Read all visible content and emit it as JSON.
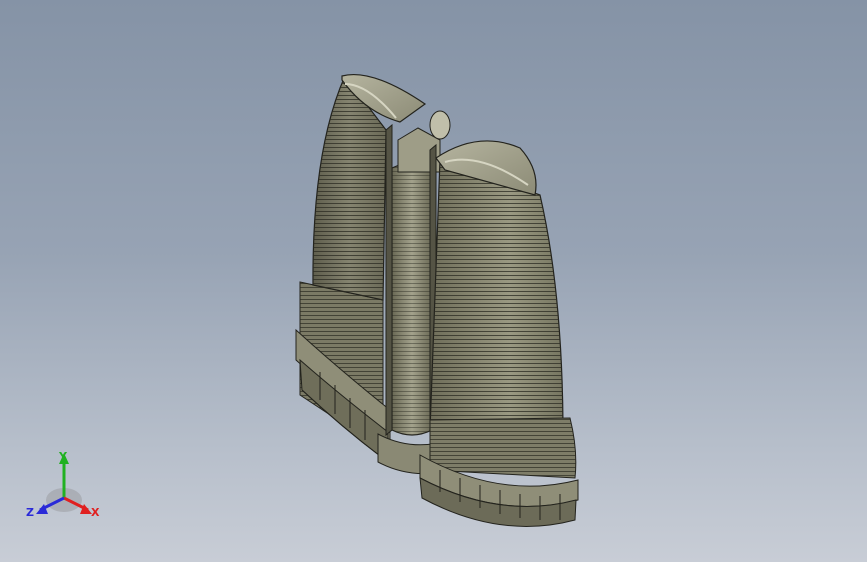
{
  "viewport": {
    "background_top": "#8593a6",
    "background_bottom": "#c8cdd6",
    "model_color": "#8d8c74",
    "edge_color": "#23231d"
  },
  "triad": {
    "x_label": "X",
    "y_label": "Y",
    "z_label": "Z",
    "x_color": "#e02020",
    "y_color": "#21b121",
    "z_color": "#2a2ad8"
  }
}
